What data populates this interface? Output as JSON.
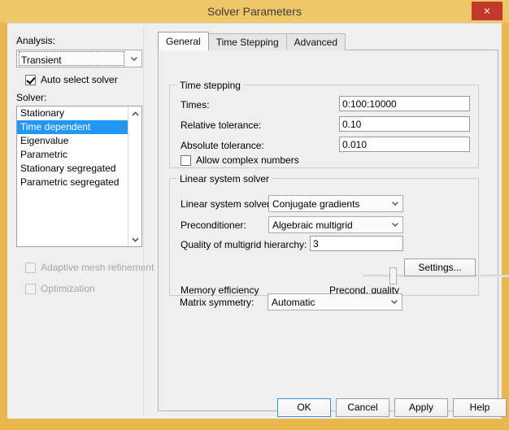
{
  "window": {
    "title": "Solver Parameters",
    "close_label": "×",
    "frame_color": "#f0c766",
    "accent_close": "#c0392b"
  },
  "left": {
    "analysis_label": "Analysis:",
    "analysis_value": "Transient",
    "auto_select_label": "Auto select solver",
    "auto_select_checked": true,
    "solver_label": "Solver:",
    "solver_items": [
      "Stationary",
      "Time dependent",
      "Eigenvalue",
      "Parametric",
      "Stationary segregated",
      "Parametric segregated"
    ],
    "solver_selected_index": 1,
    "adaptive_label": "Adaptive mesh refinement",
    "adaptive_checked": false,
    "optimization_label": "Optimization",
    "optimization_checked": false
  },
  "tabs": [
    {
      "label": "General",
      "active": true
    },
    {
      "label": "Time Stepping",
      "active": false
    },
    {
      "label": "Advanced",
      "active": false
    }
  ],
  "time_stepping": {
    "group_title": "Time stepping",
    "times_label": "Times:",
    "times_value": "0:100:10000",
    "rel_tol_label": "Relative tolerance:",
    "rel_tol_value": "0.10",
    "abs_tol_label": "Absolute tolerance:",
    "abs_tol_value": "0.010",
    "complex_label": "Allow complex numbers",
    "complex_checked": false
  },
  "linear_solver": {
    "group_title": "Linear system solver",
    "solver_label": "Linear system solver:",
    "solver_value": "Conjugate gradients",
    "precond_label": "Preconditioner:",
    "precond_value": "Algebraic multigrid",
    "quality_label": "Quality of multigrid hierarchy:",
    "quality_value": "3",
    "slider_left_label": "Memory efficiency",
    "slider_right_label": "Precond. quality",
    "slider_position_percent": 20,
    "settings_label": "Settings..."
  },
  "matrix": {
    "label": "Matrix symmetry:",
    "value": "Automatic"
  },
  "footer": {
    "ok": "OK",
    "cancel": "Cancel",
    "apply": "Apply",
    "help": "Help"
  }
}
